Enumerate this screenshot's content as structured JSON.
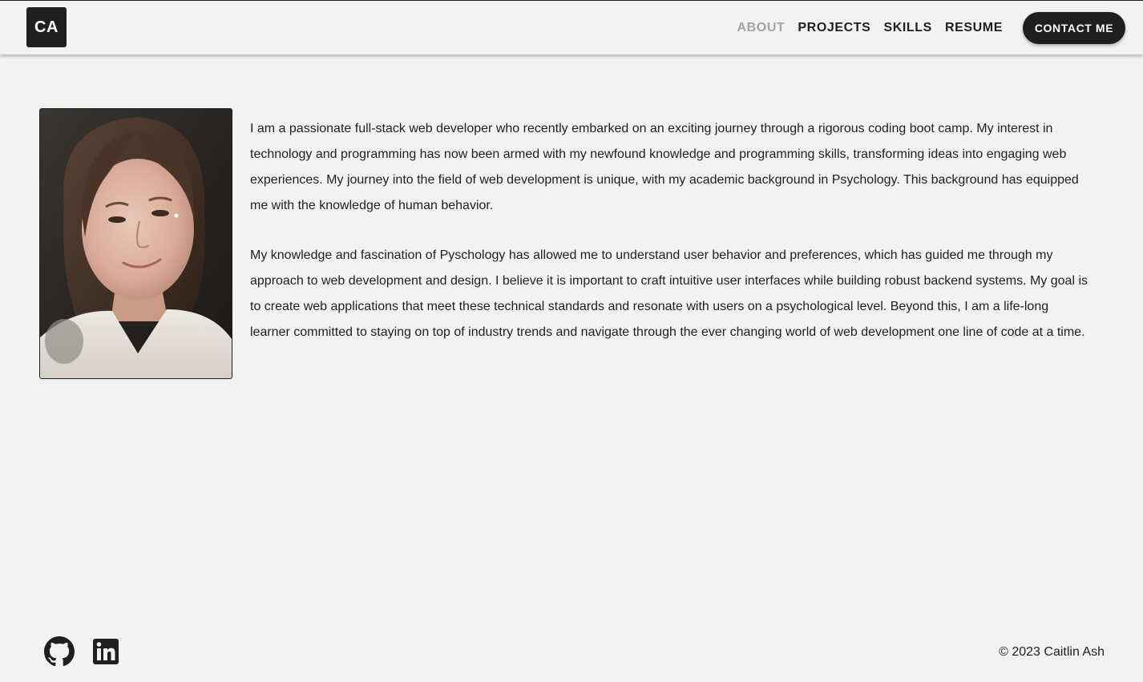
{
  "header": {
    "logo_text": "CA",
    "nav": [
      {
        "label": "ABOUT",
        "active": true
      },
      {
        "label": "PROJECTS",
        "active": false
      },
      {
        "label": "SKILLS",
        "active": false
      },
      {
        "label": "RESUME",
        "active": false
      }
    ],
    "contact_label": "CONTACT ME"
  },
  "about": {
    "paragraphs": [
      "I am a passionate full-stack web developer who recently embarked on an exciting journey through a rigorous coding boot camp. My interest in technology and programming has now been armed with my newfound knowledge and programming skills, transforming ideas into engaging web experiences. My journey into the field of web development is unique, with my academic background in Psychology. This background has equipped me with the knowledge of human behavior.",
      "My knowledge and fascination of Pyschology has allowed me to understand user behavior and preferences, which has guided me through my approach to web development and design. I believe it is important to craft intuitive user interfaces while building robust backend systems. My goal is to create web applications that meet these technical standards and resonate with users on a psychological level. Beyond this, I am a life-long learner committed to staying on top of industry trends and navigate through the ever changing world of web development one line of code at a time."
    ]
  },
  "footer": {
    "social": [
      {
        "icon": "github-icon"
      },
      {
        "icon": "linkedin-icon"
      }
    ],
    "copyright": "© 2023 Caitlin Ash"
  },
  "colors": {
    "background": "#f2f2f2",
    "dark": "#1f1f1f",
    "nav_active": "#a8a29c",
    "white": "#ffffff"
  }
}
